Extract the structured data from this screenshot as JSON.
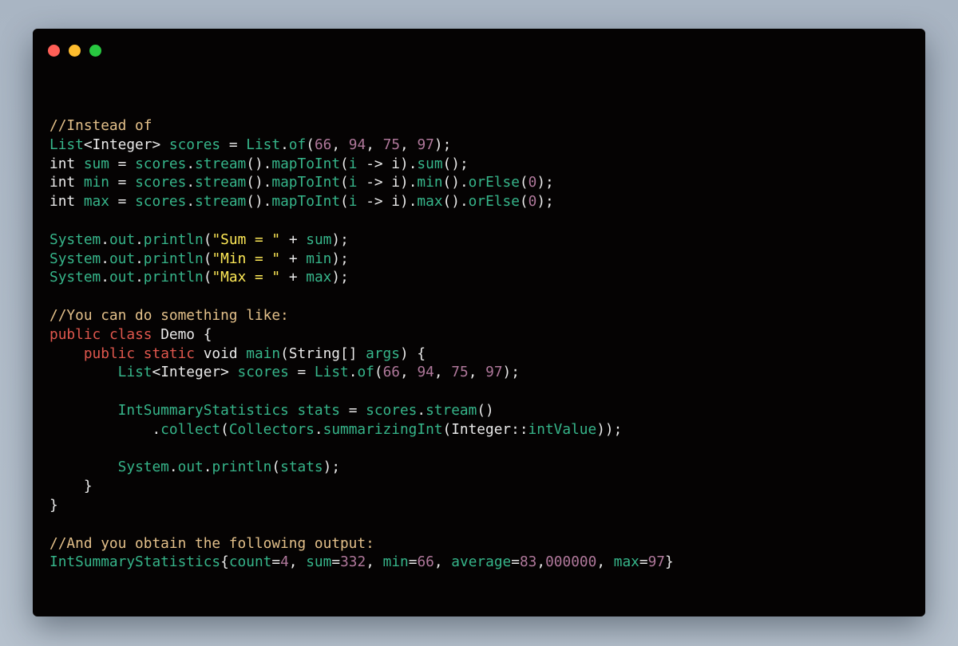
{
  "window": {
    "traffic_lights": [
      {
        "name": "close",
        "color": "#ff5f57"
      },
      {
        "name": "minimize",
        "color": "#febc2e"
      },
      {
        "name": "maximize",
        "color": "#28c840"
      }
    ]
  },
  "colors": {
    "background": "#050303",
    "comment": "#e3c08a",
    "keyword": "#e0574d",
    "type": "#36b58a",
    "number": "#b0789b",
    "string": "#ffea57",
    "plain": "#eaeaea"
  },
  "code_lines": [
    [
      [
        "comment",
        "//Instead of"
      ]
    ],
    [
      [
        "type",
        "List"
      ],
      [
        "plain",
        "<Integer> "
      ],
      [
        "ident",
        "scores"
      ],
      [
        "plain",
        " = "
      ],
      [
        "type",
        "List"
      ],
      [
        "plain",
        "."
      ],
      [
        "ident",
        "of"
      ],
      [
        "plain",
        "("
      ],
      [
        "number",
        "66"
      ],
      [
        "plain",
        ", "
      ],
      [
        "number",
        "94"
      ],
      [
        "plain",
        ", "
      ],
      [
        "number",
        "75"
      ],
      [
        "plain",
        ", "
      ],
      [
        "number",
        "97"
      ],
      [
        "plain",
        ");"
      ]
    ],
    [
      [
        "plain",
        "int "
      ],
      [
        "ident",
        "sum"
      ],
      [
        "plain",
        " = "
      ],
      [
        "ident",
        "scores"
      ],
      [
        "plain",
        "."
      ],
      [
        "ident",
        "stream"
      ],
      [
        "plain",
        "()."
      ],
      [
        "ident",
        "mapToInt"
      ],
      [
        "plain",
        "("
      ],
      [
        "ident",
        "i"
      ],
      [
        "plain",
        " -> i)."
      ],
      [
        "ident",
        "sum"
      ],
      [
        "plain",
        "();"
      ]
    ],
    [
      [
        "plain",
        "int "
      ],
      [
        "ident",
        "min"
      ],
      [
        "plain",
        " = "
      ],
      [
        "ident",
        "scores"
      ],
      [
        "plain",
        "."
      ],
      [
        "ident",
        "stream"
      ],
      [
        "plain",
        "()."
      ],
      [
        "ident",
        "mapToInt"
      ],
      [
        "plain",
        "("
      ],
      [
        "ident",
        "i"
      ],
      [
        "plain",
        " -> i)."
      ],
      [
        "ident",
        "min"
      ],
      [
        "plain",
        "()."
      ],
      [
        "ident",
        "orElse"
      ],
      [
        "plain",
        "("
      ],
      [
        "number",
        "0"
      ],
      [
        "plain",
        ");"
      ]
    ],
    [
      [
        "plain",
        "int "
      ],
      [
        "ident",
        "max"
      ],
      [
        "plain",
        " = "
      ],
      [
        "ident",
        "scores"
      ],
      [
        "plain",
        "."
      ],
      [
        "ident",
        "stream"
      ],
      [
        "plain",
        "()."
      ],
      [
        "ident",
        "mapToInt"
      ],
      [
        "plain",
        "("
      ],
      [
        "ident",
        "i"
      ],
      [
        "plain",
        " -> i)."
      ],
      [
        "ident",
        "max"
      ],
      [
        "plain",
        "()."
      ],
      [
        "ident",
        "orElse"
      ],
      [
        "plain",
        "("
      ],
      [
        "number",
        "0"
      ],
      [
        "plain",
        ");"
      ]
    ],
    [],
    [
      [
        "ident",
        "System"
      ],
      [
        "plain",
        "."
      ],
      [
        "ident",
        "out"
      ],
      [
        "plain",
        "."
      ],
      [
        "ident",
        "println"
      ],
      [
        "plain",
        "("
      ],
      [
        "string",
        "\"Sum = \""
      ],
      [
        "plain",
        " + "
      ],
      [
        "ident",
        "sum"
      ],
      [
        "plain",
        ");"
      ]
    ],
    [
      [
        "ident",
        "System"
      ],
      [
        "plain",
        "."
      ],
      [
        "ident",
        "out"
      ],
      [
        "plain",
        "."
      ],
      [
        "ident",
        "println"
      ],
      [
        "plain",
        "("
      ],
      [
        "string",
        "\"Min = \""
      ],
      [
        "plain",
        " + "
      ],
      [
        "ident",
        "min"
      ],
      [
        "plain",
        ");"
      ]
    ],
    [
      [
        "ident",
        "System"
      ],
      [
        "plain",
        "."
      ],
      [
        "ident",
        "out"
      ],
      [
        "plain",
        "."
      ],
      [
        "ident",
        "println"
      ],
      [
        "plain",
        "("
      ],
      [
        "string",
        "\"Max = \""
      ],
      [
        "plain",
        " + "
      ],
      [
        "ident",
        "max"
      ],
      [
        "plain",
        ");"
      ]
    ],
    [],
    [
      [
        "comment",
        "//You can do something like:"
      ]
    ],
    [
      [
        "keyword",
        "public"
      ],
      [
        "plain",
        " "
      ],
      [
        "keyword",
        "class"
      ],
      [
        "plain",
        " Demo {"
      ]
    ],
    [
      [
        "plain",
        "    "
      ],
      [
        "keyword",
        "public"
      ],
      [
        "plain",
        " "
      ],
      [
        "keyword",
        "static"
      ],
      [
        "plain",
        " void "
      ],
      [
        "ident",
        "main"
      ],
      [
        "plain",
        "(String[] "
      ],
      [
        "ident",
        "args"
      ],
      [
        "plain",
        ") {"
      ]
    ],
    [
      [
        "plain",
        "        "
      ],
      [
        "type",
        "List"
      ],
      [
        "plain",
        "<Integer> "
      ],
      [
        "ident",
        "scores"
      ],
      [
        "plain",
        " = "
      ],
      [
        "type",
        "List"
      ],
      [
        "plain",
        "."
      ],
      [
        "ident",
        "of"
      ],
      [
        "plain",
        "("
      ],
      [
        "number",
        "66"
      ],
      [
        "plain",
        ", "
      ],
      [
        "number",
        "94"
      ],
      [
        "plain",
        ", "
      ],
      [
        "number",
        "75"
      ],
      [
        "plain",
        ", "
      ],
      [
        "number",
        "97"
      ],
      [
        "plain",
        ");"
      ]
    ],
    [],
    [
      [
        "plain",
        "        "
      ],
      [
        "type",
        "IntSummaryStatistics"
      ],
      [
        "plain",
        " "
      ],
      [
        "ident",
        "stats"
      ],
      [
        "plain",
        " = "
      ],
      [
        "ident",
        "scores"
      ],
      [
        "plain",
        "."
      ],
      [
        "ident",
        "stream"
      ],
      [
        "plain",
        "()"
      ]
    ],
    [
      [
        "plain",
        "            ."
      ],
      [
        "ident",
        "collect"
      ],
      [
        "plain",
        "("
      ],
      [
        "ident",
        "Collectors"
      ],
      [
        "plain",
        "."
      ],
      [
        "ident",
        "summarizingInt"
      ],
      [
        "plain",
        "(Integer::"
      ],
      [
        "ident",
        "intValue"
      ],
      [
        "plain",
        "));"
      ]
    ],
    [],
    [
      [
        "plain",
        "        "
      ],
      [
        "ident",
        "System"
      ],
      [
        "plain",
        "."
      ],
      [
        "ident",
        "out"
      ],
      [
        "plain",
        "."
      ],
      [
        "ident",
        "println"
      ],
      [
        "plain",
        "("
      ],
      [
        "ident",
        "stats"
      ],
      [
        "plain",
        ");"
      ]
    ],
    [
      [
        "plain",
        "    }"
      ]
    ],
    [
      [
        "plain",
        "}"
      ]
    ],
    [],
    [
      [
        "comment",
        "//And you obtain the following output:"
      ]
    ],
    [
      [
        "type",
        "IntSummaryStatistics"
      ],
      [
        "plain",
        "{"
      ],
      [
        "ident",
        "count"
      ],
      [
        "plain",
        "="
      ],
      [
        "number",
        "4"
      ],
      [
        "plain",
        ", "
      ],
      [
        "ident",
        "sum"
      ],
      [
        "plain",
        "="
      ],
      [
        "number",
        "332"
      ],
      [
        "plain",
        ", "
      ],
      [
        "ident",
        "min"
      ],
      [
        "plain",
        "="
      ],
      [
        "number",
        "66"
      ],
      [
        "plain",
        ", "
      ],
      [
        "ident",
        "average"
      ],
      [
        "plain",
        "="
      ],
      [
        "number",
        "83"
      ],
      [
        "plain",
        ","
      ],
      [
        "number",
        "000000"
      ],
      [
        "plain",
        ", "
      ],
      [
        "ident",
        "max"
      ],
      [
        "plain",
        "="
      ],
      [
        "number",
        "97"
      ],
      [
        "plain",
        "}"
      ]
    ]
  ]
}
